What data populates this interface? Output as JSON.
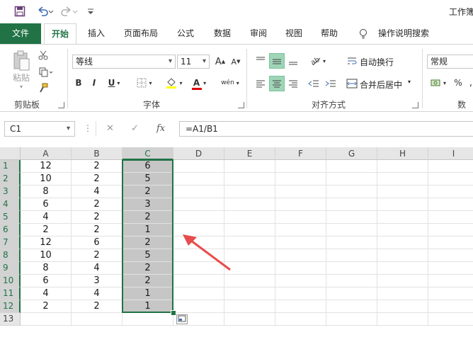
{
  "window": {
    "title": "工作簿"
  },
  "qat": {
    "save": "save-icon",
    "undo": "undo-icon",
    "redo": "redo-icon",
    "customize": "customize-icon"
  },
  "tabs": [
    "文件",
    "开始",
    "插入",
    "页面布局",
    "公式",
    "数据",
    "审阅",
    "视图",
    "帮助",
    "操作说明搜索"
  ],
  "ribbon": {
    "clipboard": {
      "paste": "粘贴",
      "label": "剪贴板"
    },
    "font": {
      "name": "等线",
      "size": "11",
      "grow": "A",
      "shrink": "A",
      "bold": "B",
      "italic": "I",
      "underline": "U",
      "fontcolor": "A",
      "phonetic": "wén",
      "label": "字体"
    },
    "alignment": {
      "wrap": "自动换行",
      "merge": "合并后居中",
      "label": "对齐方式"
    },
    "number": {
      "format": "常规",
      "percent": "%",
      "label": "数字"
    }
  },
  "formula_bar": {
    "name_box": "C1",
    "cancel": "✕",
    "enter": "✓",
    "fx": "fx",
    "formula": "=A1/B1"
  },
  "sheet": {
    "columns": [
      "A",
      "B",
      "C",
      "D",
      "E",
      "F",
      "G",
      "H",
      "I"
    ],
    "rows": [
      "1",
      "2",
      "3",
      "4",
      "5",
      "6",
      "7",
      "8",
      "9",
      "10",
      "11",
      "12",
      "13"
    ],
    "data": [
      [
        "12",
        "2",
        "6"
      ],
      [
        "10",
        "2",
        "5"
      ],
      [
        "8",
        "4",
        "2"
      ],
      [
        "6",
        "2",
        "3"
      ],
      [
        "4",
        "2",
        "2"
      ],
      [
        "2",
        "2",
        "1"
      ],
      [
        "12",
        "6",
        "2"
      ],
      [
        "10",
        "2",
        "5"
      ],
      [
        "8",
        "4",
        "2"
      ],
      [
        "6",
        "3",
        "2"
      ],
      [
        "4",
        "4",
        "1"
      ],
      [
        "2",
        "2",
        "1"
      ]
    ],
    "selected_column": "C"
  },
  "colors": {
    "accent": "#217346",
    "selection_fill": "#c6c6c6",
    "arrow": "#e84c4c"
  }
}
